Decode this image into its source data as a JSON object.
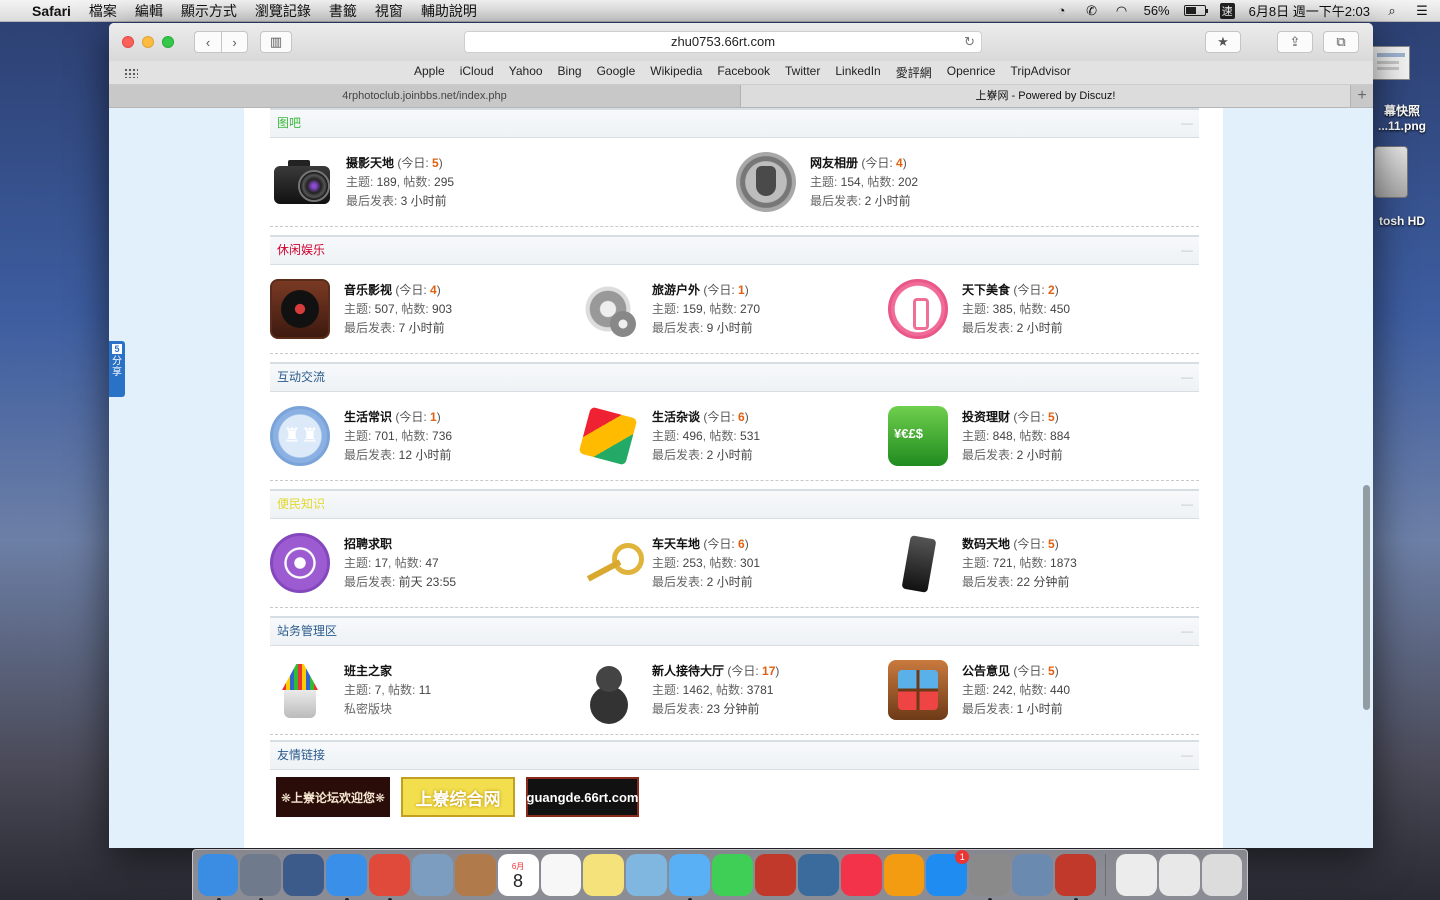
{
  "menubar": {
    "app": "Safari",
    "menus": [
      "檔案",
      "編輯",
      "顯示方式",
      "瀏覽記錄",
      "書籤",
      "視窗",
      "輔助說明"
    ],
    "battery": "56%",
    "battery_level": 0.56,
    "ime": "速",
    "clock": "6月8日 週一下午2:03"
  },
  "desktop": {
    "screenshot_label_1": "幕快照",
    "screenshot_label_2": "...11.png",
    "hd_label": "tosh HD"
  },
  "browser": {
    "url": "zhu0753.66rt.com",
    "favorites": [
      "Apple",
      "iCloud",
      "Yahoo",
      "Bing",
      "Google",
      "Wikipedia",
      "Facebook",
      "Twitter",
      "LinkedIn",
      "愛評網",
      "Openrice",
      "TripAdvisor"
    ],
    "tabs": [
      {
        "title": "4rphotoclub.joinbbs.net/index.php"
      },
      {
        "title": "上嶚网 - Powered by Discuz!"
      }
    ],
    "add_tab": "+"
  },
  "share": {
    "badge": "5",
    "label": "分享"
  },
  "labels": {
    "today": "今日: ",
    "topics": "主题: ",
    "posts": "帖数: ",
    "last": "最后发表: ",
    "collapse": "—"
  },
  "categories": [
    {
      "title": "图吧",
      "color": "#3db83d",
      "forums": [
        {
          "name": "摄影天地",
          "today": "5",
          "topics": "189",
          "posts": "295",
          "last": "3 小时前",
          "icon": "camera-icon"
        },
        {
          "name": "网友相册",
          "today": "4",
          "topics": "154",
          "posts": "202",
          "last": "2 小时前",
          "icon": "user-gray-icon"
        }
      ]
    },
    {
      "title": "休闲娱乐",
      "color": "#d1002d",
      "forums": [
        {
          "name": "音乐影视",
          "today": "4",
          "topics": "507",
          "posts": "903",
          "last": "7 小时前",
          "icon": "record-icon"
        },
        {
          "name": "旅游户外",
          "today": "1",
          "topics": "159",
          "posts": "270",
          "last": "9 小时前",
          "icon": "gear-icon"
        },
        {
          "name": "天下美食",
          "today": "2",
          "topics": "385",
          "posts": "450",
          "last": "2 小时前",
          "icon": "candle-icon"
        }
      ]
    },
    {
      "title": "互动交流",
      "color": "#2a5a8c",
      "forums": [
        {
          "name": "生活常识",
          "today": "1",
          "topics": "701",
          "posts": "736",
          "last": "12 小时前",
          "icon": "castle-icon"
        },
        {
          "name": "生活杂谈",
          "today": "6",
          "topics": "496",
          "posts": "531",
          "last": "2 小时前",
          "icon": "rubik-cube-icon"
        },
        {
          "name": "投资理财",
          "today": "5",
          "topics": "848",
          "posts": "884",
          "last": "2 小时前",
          "icon": "money-icon"
        }
      ]
    },
    {
      "title": "便民知识",
      "color": "#e2d830",
      "forums": [
        {
          "name": "招聘求职",
          "today": "",
          "topics": "17",
          "posts": "47",
          "last": "前天 23:55",
          "icon": "web-icon"
        },
        {
          "name": "车天车地",
          "today": "6",
          "topics": "253",
          "posts": "301",
          "last": "2 小时前",
          "icon": "key-icon"
        },
        {
          "name": "数码天地",
          "today": "5",
          "topics": "721",
          "posts": "1873",
          "last": "22 分钟前",
          "icon": "phone-icon"
        }
      ]
    },
    {
      "title": "站务管理区",
      "color": "#2a5a8c",
      "forums": [
        {
          "name": "班主之家",
          "today": "",
          "topics": "7",
          "posts": "11",
          "last": "",
          "private": "私密版块",
          "icon": "pencils-icon"
        },
        {
          "name": "新人接待大厅",
          "today": "17",
          "topics": "1462",
          "posts": "3781",
          "last": "23 分钟前",
          "icon": "person-icon"
        },
        {
          "name": "公告意见",
          "today": "5",
          "topics": "242",
          "posts": "440",
          "last": "1 小时前",
          "icon": "apps-icon"
        }
      ]
    }
  ],
  "links": {
    "title": "友情链接",
    "banners": [
      "❋上嶚论坛欢迎您❋",
      "上嶚综合网",
      "guangde.66rt.com"
    ]
  },
  "dock": {
    "items": [
      "Finder",
      "Launchpad",
      "Dashboard",
      "Safari",
      "Chrome",
      "Preview",
      "Contacts",
      "Calendar",
      "Reminders",
      "Notes",
      "Maps",
      "Messages",
      "FaceTime",
      "Photo Booth",
      "iPhoto",
      "iTunes",
      "iBooks",
      "App Store",
      "System Preferences",
      "Utilities",
      "FileZilla",
      "Downloads",
      "Docs",
      "Trash"
    ],
    "calendar_day": "8",
    "calendar_month": "6月",
    "appstore_badge": "1"
  }
}
